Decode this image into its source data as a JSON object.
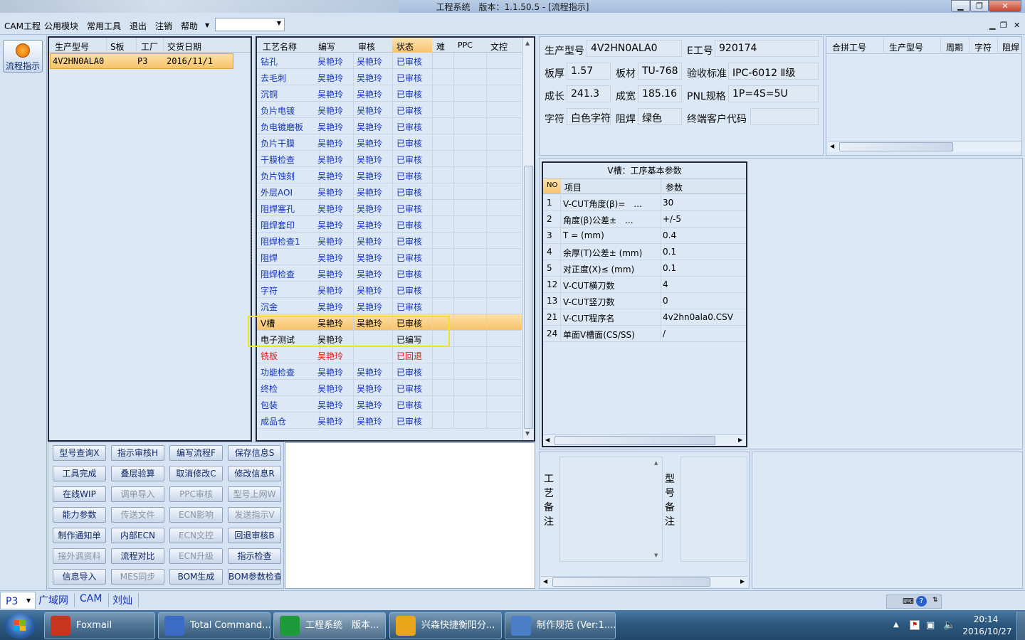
{
  "window": {
    "title": "工程系统　版本：1.1.50.5 - [流程指示]"
  },
  "menu": [
    "CAM工程",
    "公用模块",
    "常用工具",
    "退出",
    "注销",
    "帮助"
  ],
  "left_tool": {
    "label": "流程指示"
  },
  "orders": {
    "columns": [
      "生产型号",
      "S板",
      "工厂",
      "交货日期"
    ],
    "rows": [
      {
        "model": "4V2HN0ALA0",
        "s": "",
        "factory": "P3",
        "date": "2016/11/1"
      }
    ]
  },
  "process": {
    "columns": [
      "工艺名称",
      "编写",
      "审核",
      "状态",
      "难",
      "PPC",
      "文控"
    ],
    "rows": [
      {
        "name": "钻孔",
        "writer": "吴艳玲",
        "reviewer": "吴艳玲",
        "status": "已审核",
        "tone": "normal"
      },
      {
        "name": "去毛刺",
        "writer": "吴艳玲",
        "reviewer": "吴艳玲",
        "status": "已审核",
        "tone": "normal"
      },
      {
        "name": "沉铜",
        "writer": "吴艳玲",
        "reviewer": "吴艳玲",
        "status": "已审核",
        "tone": "normal"
      },
      {
        "name": "负片电镀",
        "writer": "吴艳玲",
        "reviewer": "吴艳玲",
        "status": "已审核",
        "tone": "normal"
      },
      {
        "name": "负电镀磨板",
        "writer": "吴艳玲",
        "reviewer": "吴艳玲",
        "status": "已审核",
        "tone": "normal"
      },
      {
        "name": "负片干膜",
        "writer": "吴艳玲",
        "reviewer": "吴艳玲",
        "status": "已审核",
        "tone": "normal"
      },
      {
        "name": "干膜检查",
        "writer": "吴艳玲",
        "reviewer": "吴艳玲",
        "status": "已审核",
        "tone": "normal"
      },
      {
        "name": "负片蚀刻",
        "writer": "吴艳玲",
        "reviewer": "吴艳玲",
        "status": "已审核",
        "tone": "normal"
      },
      {
        "name": "外层AOI",
        "writer": "吴艳玲",
        "reviewer": "吴艳玲",
        "status": "已审核",
        "tone": "normal"
      },
      {
        "name": "阻焊塞孔",
        "writer": "吴艳玲",
        "reviewer": "吴艳玲",
        "status": "已审核",
        "tone": "normal"
      },
      {
        "name": "阻焊套印",
        "writer": "吴艳玲",
        "reviewer": "吴艳玲",
        "status": "已审核",
        "tone": "normal"
      },
      {
        "name": "阻焊检查1",
        "writer": "吴艳玲",
        "reviewer": "吴艳玲",
        "status": "已审核",
        "tone": "normal"
      },
      {
        "name": "阻焊",
        "writer": "吴艳玲",
        "reviewer": "吴艳玲",
        "status": "已审核",
        "tone": "normal"
      },
      {
        "name": "阻焊检查",
        "writer": "吴艳玲",
        "reviewer": "吴艳玲",
        "status": "已审核",
        "tone": "normal"
      },
      {
        "name": "字符",
        "writer": "吴艳玲",
        "reviewer": "吴艳玲",
        "status": "已审核",
        "tone": "normal"
      },
      {
        "name": "沉金",
        "writer": "吴艳玲",
        "reviewer": "吴艳玲",
        "status": "已审核",
        "tone": "normal"
      },
      {
        "name": "V槽",
        "writer": "吴艳玲",
        "reviewer": "吴艳玲",
        "status": "已审核",
        "tone": "selected"
      },
      {
        "name": "电子测试",
        "writer": "吴艳玲",
        "reviewer": "",
        "status": "已编写",
        "tone": "written"
      },
      {
        "name": "铣板",
        "writer": "吴艳玲",
        "reviewer": "",
        "status": "已回退",
        "tone": "returned"
      },
      {
        "name": "功能检查",
        "writer": "吴艳玲",
        "reviewer": "吴艳玲",
        "status": "已审核",
        "tone": "normal"
      },
      {
        "name": "终检",
        "writer": "吴艳玲",
        "reviewer": "吴艳玲",
        "status": "已审核",
        "tone": "normal"
      },
      {
        "name": "包装",
        "writer": "吴艳玲",
        "reviewer": "吴艳玲",
        "status": "已审核",
        "tone": "normal"
      },
      {
        "name": "成品仓",
        "writer": "吴艳玲",
        "reviewer": "吴艳玲",
        "status": "已审核",
        "tone": "normal"
      }
    ]
  },
  "buttons": [
    [
      {
        "label": "型号查询X",
        "disabled": false
      },
      {
        "label": "指示审核H",
        "disabled": false
      },
      {
        "label": "编写流程F",
        "disabled": false
      },
      {
        "label": "保存信息S",
        "disabled": false
      }
    ],
    [
      {
        "label": "工具完成",
        "disabled": false
      },
      {
        "label": "叠层验算",
        "disabled": false
      },
      {
        "label": "取消修改C",
        "disabled": false
      },
      {
        "label": "修改信息R",
        "disabled": false
      }
    ],
    [
      {
        "label": "在线WIP",
        "disabled": false
      },
      {
        "label": "调单导入",
        "disabled": true
      },
      {
        "label": "PPC审核",
        "disabled": true
      },
      {
        "label": "型号上网W",
        "disabled": true
      }
    ],
    [
      {
        "label": "能力参数",
        "disabled": false
      },
      {
        "label": "传送文件",
        "disabled": true
      },
      {
        "label": "ECN影响",
        "disabled": true
      },
      {
        "label": "发送指示V",
        "disabled": true
      }
    ],
    [
      {
        "label": "制作通知单",
        "disabled": false
      },
      {
        "label": "内部ECN",
        "disabled": false
      },
      {
        "label": "ECN文控",
        "disabled": true
      },
      {
        "label": "回退审核B",
        "disabled": false
      }
    ],
    [
      {
        "label": "接外调资料",
        "disabled": true
      },
      {
        "label": "流程对比",
        "disabled": false
      },
      {
        "label": "ECN升级",
        "disabled": true
      },
      {
        "label": "指示检查",
        "disabled": false
      }
    ],
    [
      {
        "label": "信息导入",
        "disabled": false
      },
      {
        "label": "MES同步",
        "disabled": true
      },
      {
        "label": "BOM生成",
        "disabled": false
      },
      {
        "label": "BOM参数检查",
        "disabled": false
      }
    ]
  ],
  "info": {
    "model_label": "生产型号",
    "model": "4V2HN0ALA0",
    "eno_label": "E工号",
    "eno": "920174",
    "thickness_label": "板厚",
    "thickness": "1.57",
    "material_label": "板材",
    "material": "TU-768",
    "standard_label": "验收标准",
    "standard": "IPC-6012 Ⅱ级",
    "length_label": "成长",
    "length": "241.3",
    "width_label": "成宽",
    "width": "185.16",
    "pnl_label": "PNL规格",
    "pnl": "1P=4S=5U",
    "char_label": "字符",
    "char": "白色字符",
    "mask_label": "阻焊",
    "mask": "绿色",
    "customer_label": "终端客户代码",
    "customer": ""
  },
  "combine": {
    "columns": [
      "合拼工号",
      "生产型号",
      "周期",
      "字符",
      "阻焊"
    ]
  },
  "params": {
    "title": "V槽：工序基本参数",
    "columns": [
      "NO",
      "项目",
      "参数"
    ],
    "rows": [
      {
        "no": "1",
        "item": "V-CUT角度(β)=　...",
        "value": "30"
      },
      {
        "no": "2",
        "item": "角度(β)公差±　...",
        "value": "+/-5"
      },
      {
        "no": "3",
        "item": "T = (mm)",
        "value": "0.4"
      },
      {
        "no": "4",
        "item": "余厚(T)公差± (mm)",
        "value": "0.1"
      },
      {
        "no": "5",
        "item": "对正度(X)≤ (mm)",
        "value": "0.1"
      },
      {
        "no": "12",
        "item": "V-CUT横刀数",
        "value": "4"
      },
      {
        "no": "13",
        "item": "V-CUT竖刀数",
        "value": "0"
      },
      {
        "no": "21",
        "item": "V-CUT程序名",
        "value": "4v2hn0ala0.CSV"
      },
      {
        "no": "24",
        "item": "单面V槽面(CS/SS)",
        "value": "/"
      }
    ]
  },
  "notes": {
    "process_label": [
      "工",
      "艺",
      "备",
      "注"
    ],
    "model_label": [
      "型",
      "号",
      "备",
      "注"
    ]
  },
  "status": {
    "factory": "P3",
    "items": [
      "广域网",
      "CAM",
      "刘灿"
    ]
  },
  "taskbar": {
    "tasks": [
      "Foxmail",
      "Total Command...",
      "工程系统　版本...",
      "兴森快捷衡阳分...",
      "制作规范 (Ver:1...."
    ],
    "time": "20:14",
    "date": "2016/10/27"
  }
}
